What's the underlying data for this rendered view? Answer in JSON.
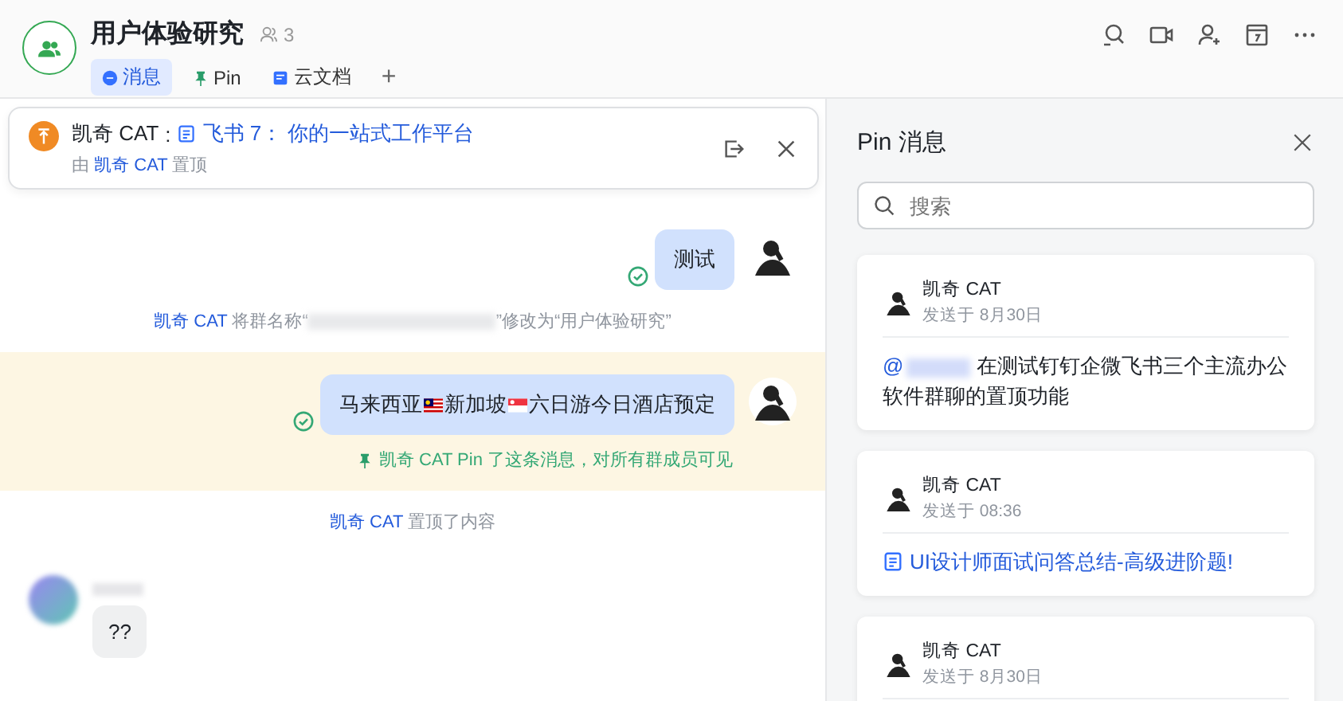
{
  "header": {
    "title": "用户体验研究",
    "member_count": "3",
    "add_tab": "+",
    "tabs": [
      {
        "label": "消息",
        "kind": "chat",
        "selected": true
      },
      {
        "label": "Pin",
        "kind": "pin",
        "selected": false
      },
      {
        "label": "云文档",
        "kind": "doc",
        "selected": false
      }
    ]
  },
  "pinned_banner": {
    "sender": "凯奇 CAT",
    "separator": ":",
    "doc_title": "飞书 7： 你的一站式工作平台",
    "by_prefix": "由",
    "by_name": "凯奇 CAT",
    "by_suffix": "置顶"
  },
  "messages": [
    {
      "kind": "outgoing",
      "highlighted": false,
      "read": true,
      "parts": [
        {
          "kind": "text",
          "text": "测试"
        }
      ]
    },
    {
      "kind": "system",
      "actor": "凯奇 CAT",
      "before": "将群名称“",
      "redacted": true,
      "after": "”修改为“用户体验研究”"
    },
    {
      "kind": "outgoing",
      "highlighted": true,
      "read": true,
      "pin_note": "凯奇 CAT Pin 了这条消息，对所有群成员可见",
      "parts": [
        {
          "kind": "text",
          "text": "马来西亚"
        },
        {
          "kind": "flag_my"
        },
        {
          "kind": "text",
          "text": "新加坡"
        },
        {
          "kind": "flag_sg"
        },
        {
          "kind": "text",
          "text": "六日游今日酒店预定"
        }
      ]
    },
    {
      "kind": "system",
      "actor": "凯奇 CAT",
      "before": "置顶了内容",
      "redacted": false
    },
    {
      "kind": "incoming",
      "text": "??"
    }
  ],
  "pin_panel": {
    "title": "Pin 消息",
    "search": {
      "placeholder": "搜索"
    },
    "pins": [
      {
        "kind": "text",
        "sender": "凯奇 CAT",
        "time": "发送于 8月30日",
        "mention": "@",
        "text": "在测试钉钉企微飞书三个主流办公软件群聊的置顶功能"
      },
      {
        "kind": "doc",
        "sender": "凯奇 CAT",
        "time": "发送于 08:36",
        "text": "UI设计师面试问答总结-高级进阶题!"
      },
      {
        "kind": "cut",
        "sender": "凯奇 CAT",
        "time": "发送于 8月30日"
      }
    ]
  }
}
